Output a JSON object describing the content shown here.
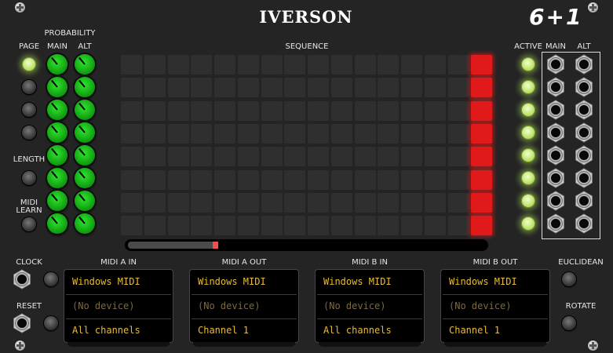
{
  "module": {
    "title": "IVERSON",
    "brand_logo": "6+1"
  },
  "labels": {
    "probability": "PROBABILITY",
    "main": "MAIN",
    "alt": "ALT",
    "page": "PAGE",
    "length": "LENGTH",
    "midi_learn_line1": "MIDI",
    "midi_learn_line2": "LEARN",
    "sequence": "SEQUENCE",
    "active": "ACTIVE",
    "out_main": "MAIN",
    "out_alt": "ALT",
    "clock": "CLOCK",
    "reset": "RESET",
    "euclidean": "EUCLIDEAN",
    "rotate": "ROTATE"
  },
  "sequence": {
    "rows": 8,
    "columns": 16,
    "active_column": 15,
    "progress": 0.25
  },
  "knob_angles_deg": {
    "main": [
      -40,
      -40,
      -40,
      -40,
      -40,
      -40,
      -40,
      -40
    ],
    "alt": [
      -40,
      -40,
      -40,
      -40,
      -40,
      -40,
      -40,
      -40
    ]
  },
  "midi_panels": [
    {
      "title": "MIDI A IN",
      "driver": "Windows MIDI",
      "device": "(No device)",
      "channel": "All channels"
    },
    {
      "title": "MIDI A OUT",
      "driver": "Windows MIDI",
      "device": "(No device)",
      "channel": "Channel 1"
    },
    {
      "title": "MIDI B IN",
      "driver": "Windows MIDI",
      "device": "(No device)",
      "channel": "All channels"
    },
    {
      "title": "MIDI B OUT",
      "driver": "Windows MIDI",
      "device": "(No device)",
      "channel": "Channel 1"
    }
  ],
  "colors": {
    "panel": "#242424",
    "step_off": "#2f2f2f",
    "step_on": "#e01a1a",
    "led_green": "#bde36a",
    "knob_green": "#14a414",
    "midi_text": "#e8b93a"
  },
  "icons": {
    "screw": "screw-icon",
    "jack": "jack-socket-icon"
  }
}
